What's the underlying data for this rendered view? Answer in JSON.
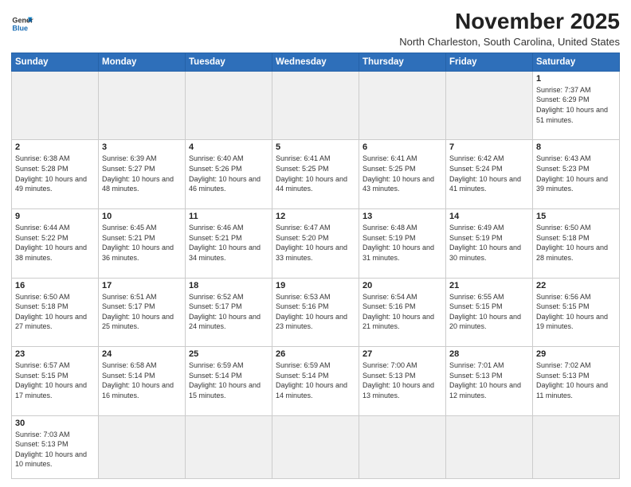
{
  "header": {
    "logo_general": "General",
    "logo_blue": "Blue",
    "month_title": "November 2025",
    "location": "North Charleston, South Carolina, United States"
  },
  "weekdays": [
    "Sunday",
    "Monday",
    "Tuesday",
    "Wednesday",
    "Thursday",
    "Friday",
    "Saturday"
  ],
  "weeks": [
    [
      {
        "day": "",
        "info": ""
      },
      {
        "day": "",
        "info": ""
      },
      {
        "day": "",
        "info": ""
      },
      {
        "day": "",
        "info": ""
      },
      {
        "day": "",
        "info": ""
      },
      {
        "day": "",
        "info": ""
      },
      {
        "day": "1",
        "info": "Sunrise: 7:37 AM\nSunset: 6:29 PM\nDaylight: 10 hours and 51 minutes."
      }
    ],
    [
      {
        "day": "2",
        "info": "Sunrise: 6:38 AM\nSunset: 5:28 PM\nDaylight: 10 hours and 49 minutes."
      },
      {
        "day": "3",
        "info": "Sunrise: 6:39 AM\nSunset: 5:27 PM\nDaylight: 10 hours and 48 minutes."
      },
      {
        "day": "4",
        "info": "Sunrise: 6:40 AM\nSunset: 5:26 PM\nDaylight: 10 hours and 46 minutes."
      },
      {
        "day": "5",
        "info": "Sunrise: 6:41 AM\nSunset: 5:25 PM\nDaylight: 10 hours and 44 minutes."
      },
      {
        "day": "6",
        "info": "Sunrise: 6:41 AM\nSunset: 5:25 PM\nDaylight: 10 hours and 43 minutes."
      },
      {
        "day": "7",
        "info": "Sunrise: 6:42 AM\nSunset: 5:24 PM\nDaylight: 10 hours and 41 minutes."
      },
      {
        "day": "8",
        "info": "Sunrise: 6:43 AM\nSunset: 5:23 PM\nDaylight: 10 hours and 39 minutes."
      }
    ],
    [
      {
        "day": "9",
        "info": "Sunrise: 6:44 AM\nSunset: 5:22 PM\nDaylight: 10 hours and 38 minutes."
      },
      {
        "day": "10",
        "info": "Sunrise: 6:45 AM\nSunset: 5:21 PM\nDaylight: 10 hours and 36 minutes."
      },
      {
        "day": "11",
        "info": "Sunrise: 6:46 AM\nSunset: 5:21 PM\nDaylight: 10 hours and 34 minutes."
      },
      {
        "day": "12",
        "info": "Sunrise: 6:47 AM\nSunset: 5:20 PM\nDaylight: 10 hours and 33 minutes."
      },
      {
        "day": "13",
        "info": "Sunrise: 6:48 AM\nSunset: 5:19 PM\nDaylight: 10 hours and 31 minutes."
      },
      {
        "day": "14",
        "info": "Sunrise: 6:49 AM\nSunset: 5:19 PM\nDaylight: 10 hours and 30 minutes."
      },
      {
        "day": "15",
        "info": "Sunrise: 6:50 AM\nSunset: 5:18 PM\nDaylight: 10 hours and 28 minutes."
      }
    ],
    [
      {
        "day": "16",
        "info": "Sunrise: 6:50 AM\nSunset: 5:18 PM\nDaylight: 10 hours and 27 minutes."
      },
      {
        "day": "17",
        "info": "Sunrise: 6:51 AM\nSunset: 5:17 PM\nDaylight: 10 hours and 25 minutes."
      },
      {
        "day": "18",
        "info": "Sunrise: 6:52 AM\nSunset: 5:17 PM\nDaylight: 10 hours and 24 minutes."
      },
      {
        "day": "19",
        "info": "Sunrise: 6:53 AM\nSunset: 5:16 PM\nDaylight: 10 hours and 23 minutes."
      },
      {
        "day": "20",
        "info": "Sunrise: 6:54 AM\nSunset: 5:16 PM\nDaylight: 10 hours and 21 minutes."
      },
      {
        "day": "21",
        "info": "Sunrise: 6:55 AM\nSunset: 5:15 PM\nDaylight: 10 hours and 20 minutes."
      },
      {
        "day": "22",
        "info": "Sunrise: 6:56 AM\nSunset: 5:15 PM\nDaylight: 10 hours and 19 minutes."
      }
    ],
    [
      {
        "day": "23",
        "info": "Sunrise: 6:57 AM\nSunset: 5:15 PM\nDaylight: 10 hours and 17 minutes."
      },
      {
        "day": "24",
        "info": "Sunrise: 6:58 AM\nSunset: 5:14 PM\nDaylight: 10 hours and 16 minutes."
      },
      {
        "day": "25",
        "info": "Sunrise: 6:59 AM\nSunset: 5:14 PM\nDaylight: 10 hours and 15 minutes."
      },
      {
        "day": "26",
        "info": "Sunrise: 6:59 AM\nSunset: 5:14 PM\nDaylight: 10 hours and 14 minutes."
      },
      {
        "day": "27",
        "info": "Sunrise: 7:00 AM\nSunset: 5:13 PM\nDaylight: 10 hours and 13 minutes."
      },
      {
        "day": "28",
        "info": "Sunrise: 7:01 AM\nSunset: 5:13 PM\nDaylight: 10 hours and 12 minutes."
      },
      {
        "day": "29",
        "info": "Sunrise: 7:02 AM\nSunset: 5:13 PM\nDaylight: 10 hours and 11 minutes."
      }
    ],
    [
      {
        "day": "30",
        "info": "Sunrise: 7:03 AM\nSunset: 5:13 PM\nDaylight: 10 hours and 10 minutes."
      },
      {
        "day": "",
        "info": ""
      },
      {
        "day": "",
        "info": ""
      },
      {
        "day": "",
        "info": ""
      },
      {
        "day": "",
        "info": ""
      },
      {
        "day": "",
        "info": ""
      },
      {
        "day": "",
        "info": ""
      }
    ]
  ]
}
